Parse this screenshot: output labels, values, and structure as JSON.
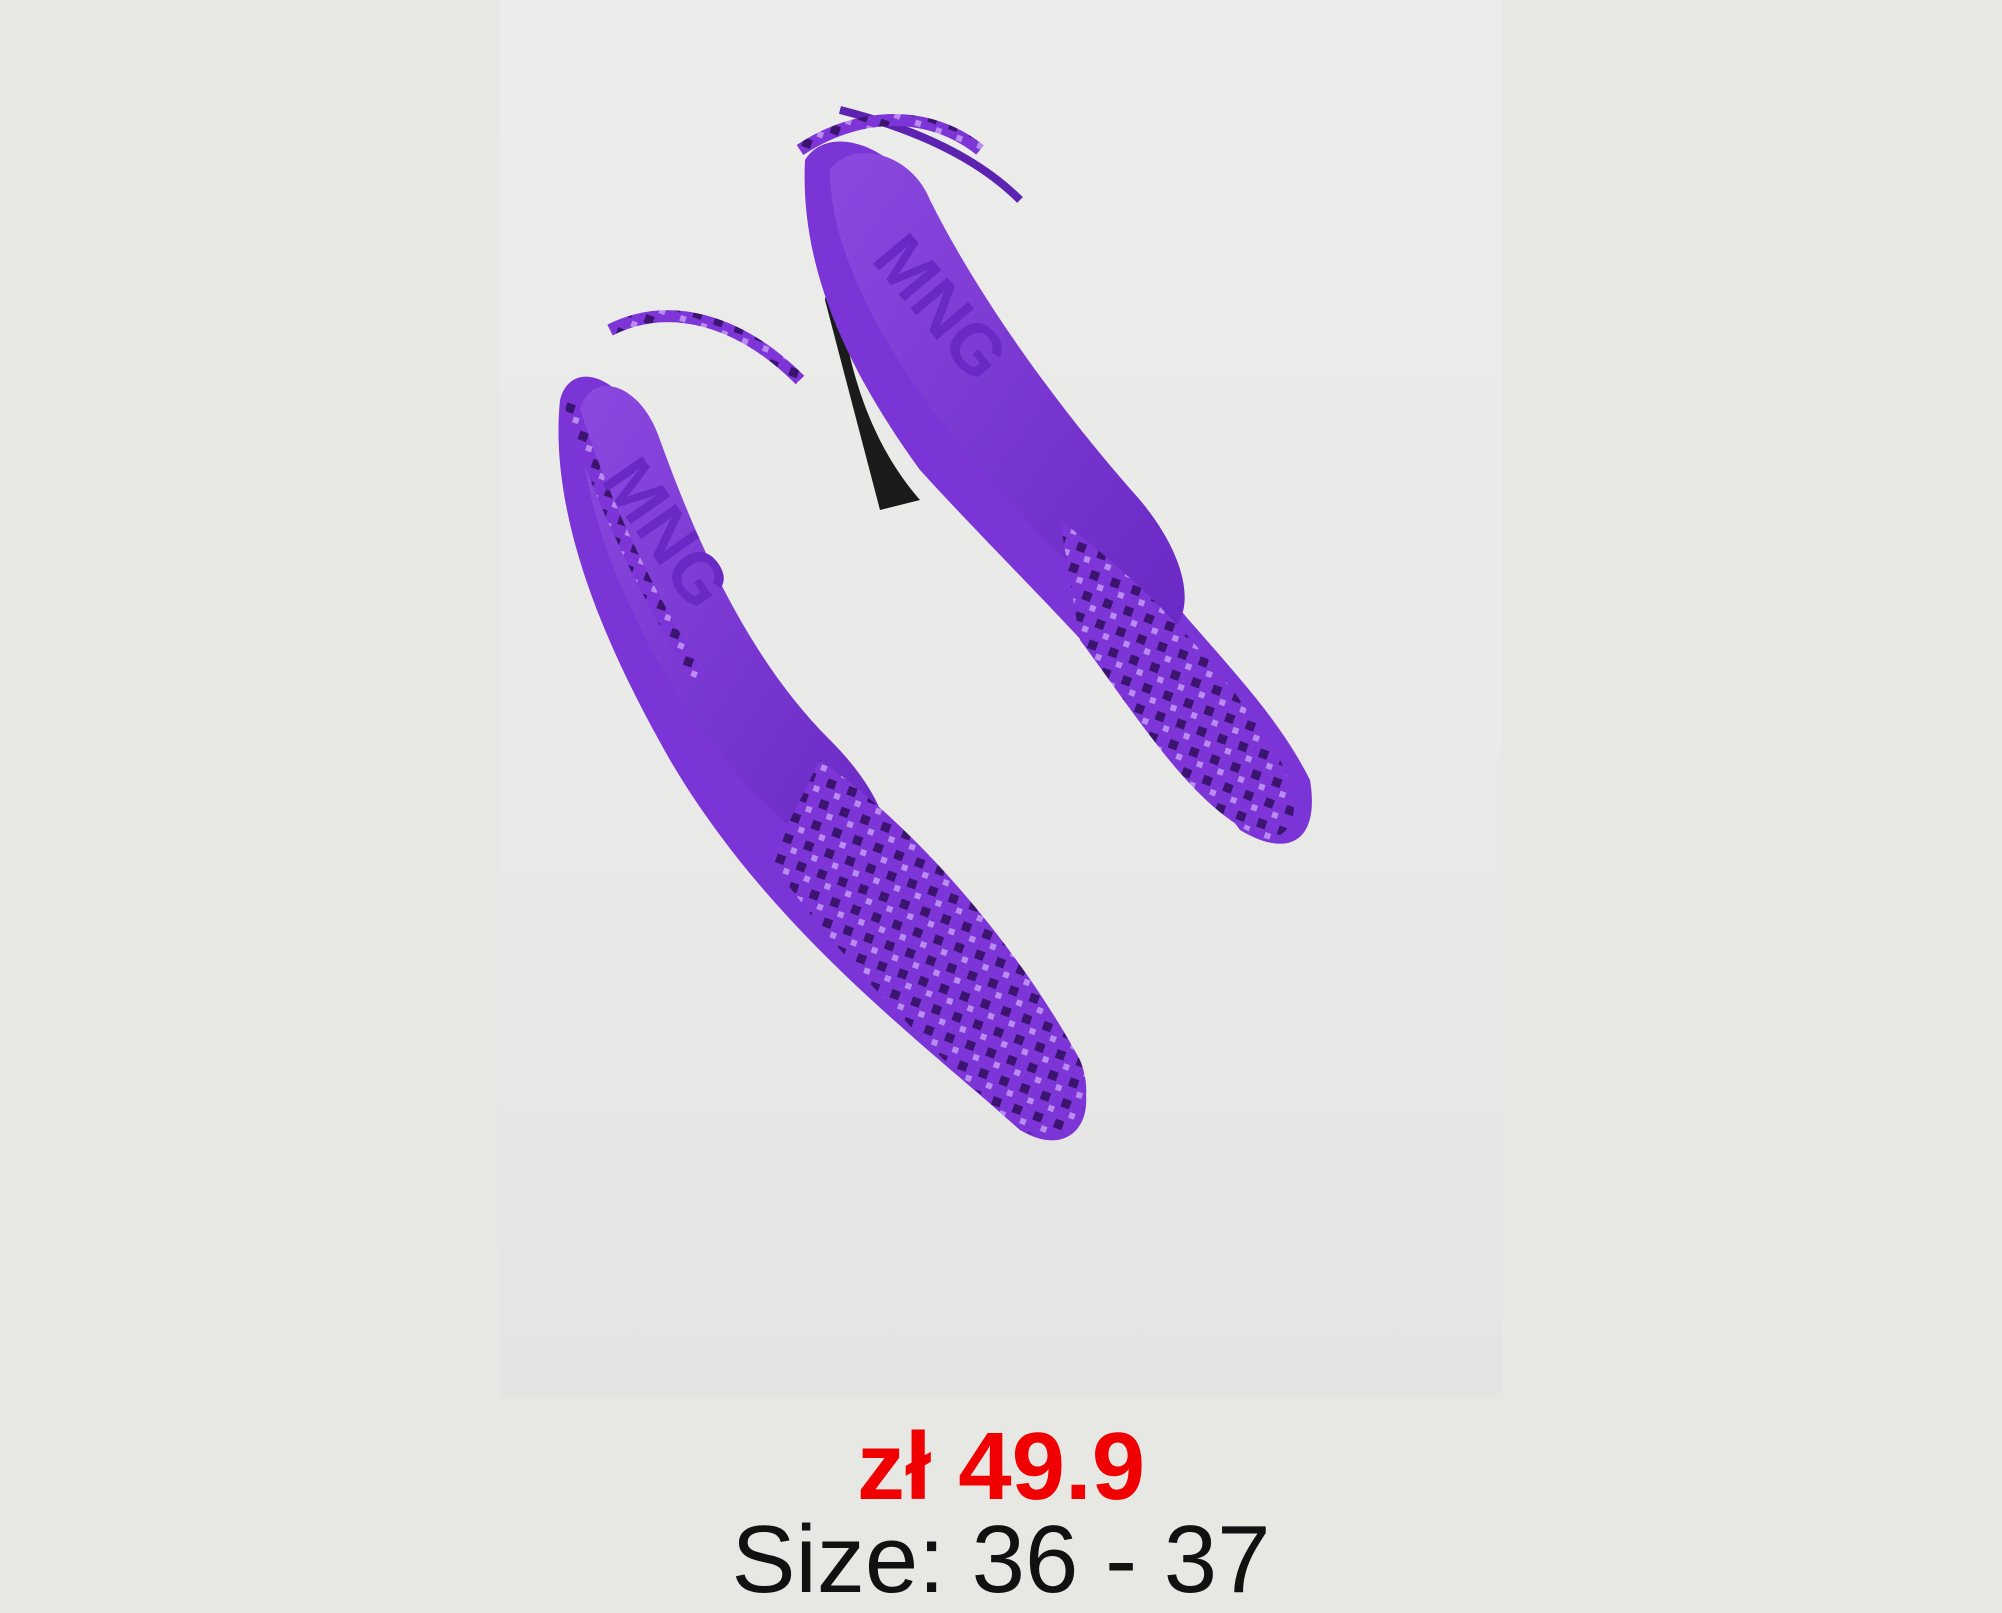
{
  "product": {
    "price": "zł 49.9",
    "size": "Size: 36 - 37",
    "image_alt": "Purple crystal-embellished slingback pumps",
    "logo_text": "MNG"
  },
  "colors": {
    "price": "#f00000",
    "shoe": "#7b34d6",
    "shoe_dark": "#4a1a8f",
    "heel": "#1b1b1b",
    "background": "#e7e7e4"
  }
}
